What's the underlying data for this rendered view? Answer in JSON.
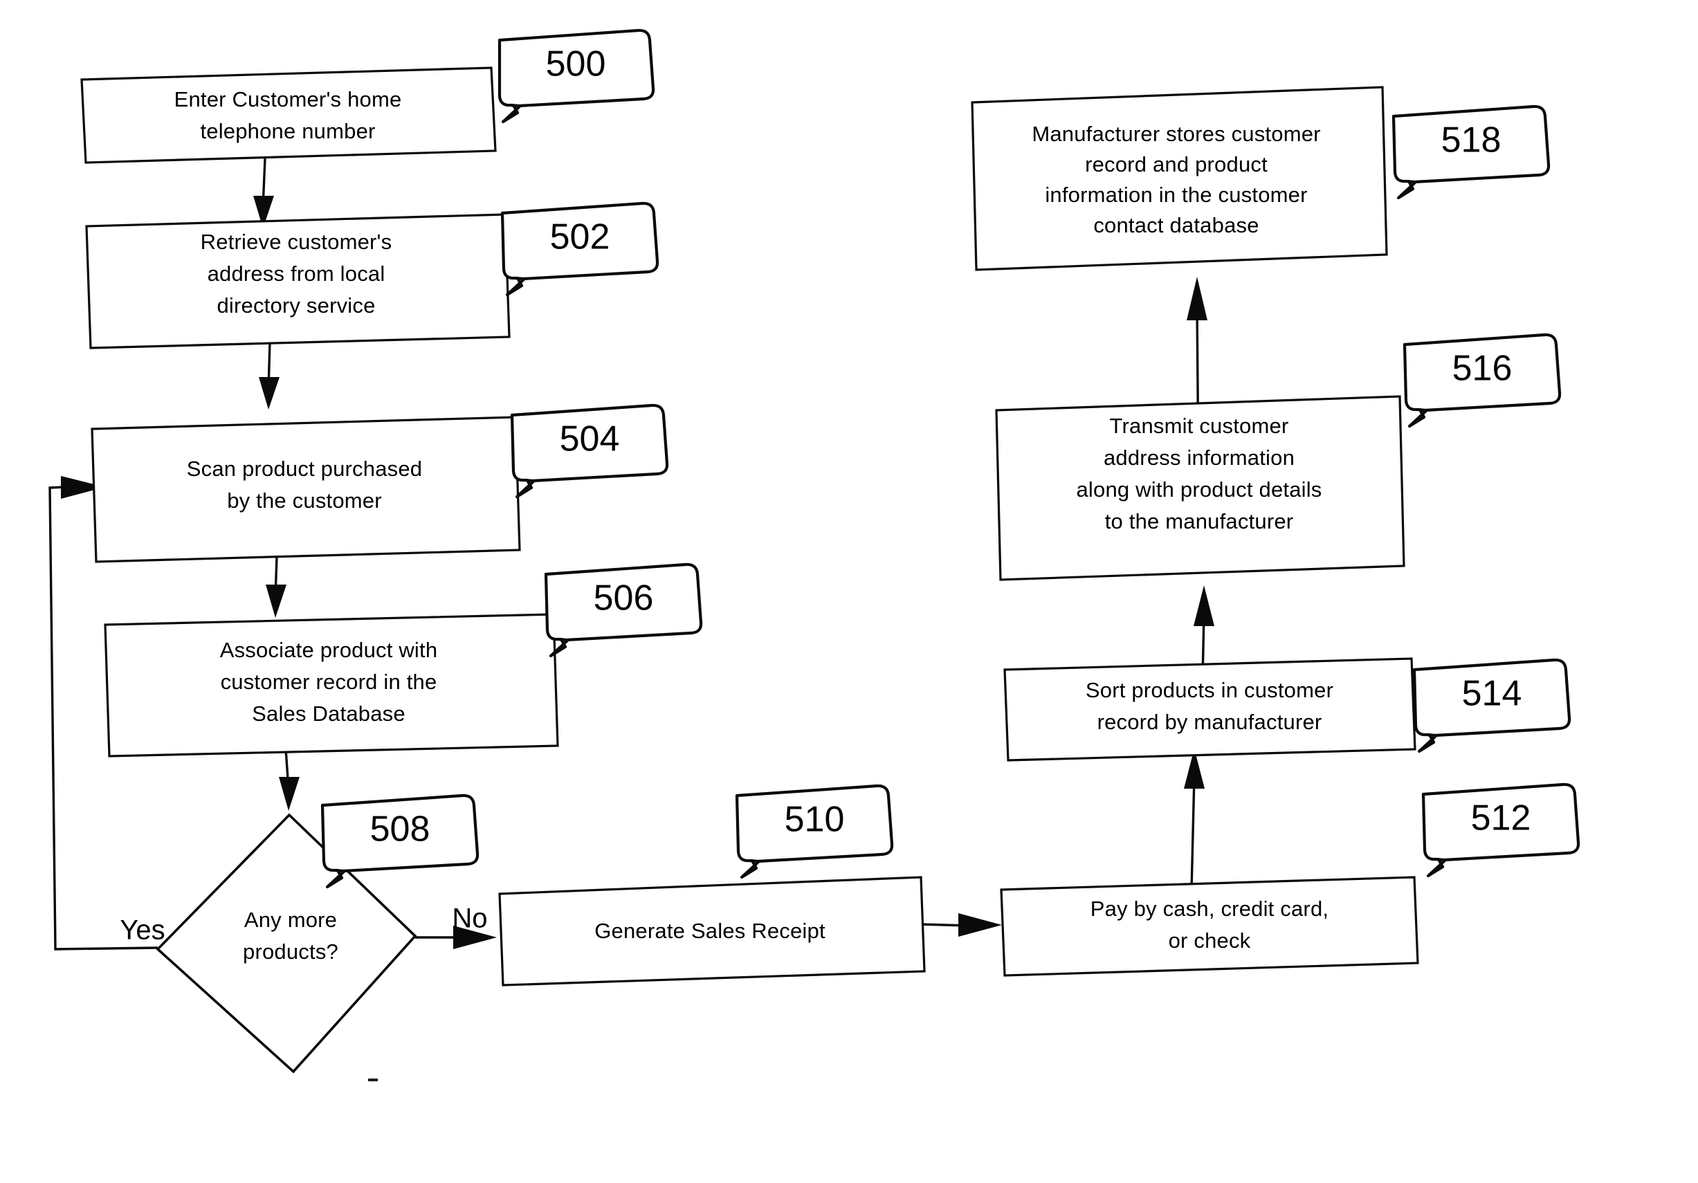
{
  "figure": {
    "type": "patent-flowchart",
    "title": "",
    "background_color": "#ffffff",
    "line_color": "#0a0a0a",
    "text_color": "#000000"
  },
  "nodes": [
    {
      "id": "n500",
      "shape": "process",
      "ref": "500",
      "lines": [
        "Enter Customer's home",
        "telephone number"
      ]
    },
    {
      "id": "n502",
      "shape": "process",
      "ref": "502",
      "lines": [
        "Retrieve customer's",
        "address from local",
        "directory service"
      ]
    },
    {
      "id": "n504",
      "shape": "process",
      "ref": "504",
      "lines": [
        "Scan product purchased",
        "by the customer"
      ]
    },
    {
      "id": "n506",
      "shape": "process",
      "ref": "506",
      "lines": [
        "Associate product with",
        "customer record in the",
        "Sales Database"
      ]
    },
    {
      "id": "n508",
      "shape": "decision",
      "ref": "508",
      "lines": [
        "Any more",
        "products?"
      ]
    },
    {
      "id": "n510",
      "shape": "process",
      "ref": "510",
      "lines": [
        "Generate Sales Receipt"
      ]
    },
    {
      "id": "n512",
      "shape": "process",
      "ref": "512",
      "lines": [
        "Pay by cash, credit card,",
        "or check"
      ]
    },
    {
      "id": "n514",
      "shape": "process",
      "ref": "514",
      "lines": [
        "Sort products in customer",
        "record by manufacturer"
      ]
    },
    {
      "id": "n516",
      "shape": "process",
      "ref": "516",
      "lines": [
        "Transmit customer",
        "address information",
        "along with product details",
        "to the manufacturer"
      ]
    },
    {
      "id": "n518",
      "shape": "process",
      "ref": "518",
      "lines": [
        "Manufacturer stores customer",
        "record and product",
        "information in the customer",
        "contact database"
      ]
    }
  ],
  "callouts": [
    {
      "id": "c500",
      "label": "500"
    },
    {
      "id": "c502",
      "label": "502"
    },
    {
      "id": "c504",
      "label": "504"
    },
    {
      "id": "c506",
      "label": "506"
    },
    {
      "id": "c508",
      "label": "508"
    },
    {
      "id": "c510",
      "label": "510"
    },
    {
      "id": "c512",
      "label": "512"
    },
    {
      "id": "c514",
      "label": "514"
    },
    {
      "id": "c516",
      "label": "516"
    },
    {
      "id": "c518",
      "label": "518"
    }
  ],
  "edge_labels": [
    {
      "id": "lbl_yes",
      "label": "Yes"
    },
    {
      "id": "lbl_no",
      "label": "No"
    }
  ],
  "edges": [
    {
      "from": "n500",
      "to": "n502",
      "label": ""
    },
    {
      "from": "n502",
      "to": "n504",
      "label": ""
    },
    {
      "from": "n504",
      "to": "n506",
      "label": ""
    },
    {
      "from": "n506",
      "to": "n508",
      "label": ""
    },
    {
      "from": "n508",
      "to": "n504",
      "label": "Yes"
    },
    {
      "from": "n508",
      "to": "n510",
      "label": "No"
    },
    {
      "from": "n510",
      "to": "n512",
      "label": ""
    },
    {
      "from": "n512",
      "to": "n514",
      "label": ""
    },
    {
      "from": "n514",
      "to": "n516",
      "label": ""
    },
    {
      "from": "n516",
      "to": "n518",
      "label": ""
    }
  ]
}
